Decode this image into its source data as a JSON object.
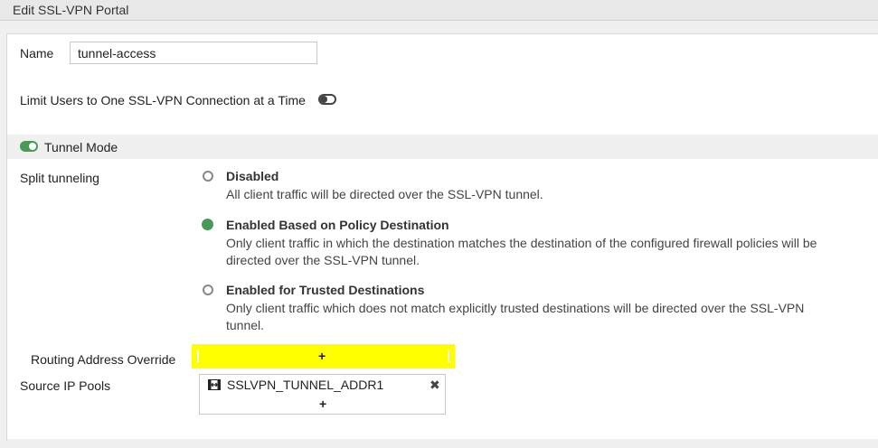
{
  "window": {
    "title": "Edit SSL-VPN Portal"
  },
  "form": {
    "name_label": "Name",
    "name_value": "tunnel-access",
    "limit_users_label": "Limit Users to One SSL-VPN Connection at a Time",
    "tunnel_mode_label": "Tunnel Mode",
    "split_tunneling_label": "Split tunneling",
    "options": [
      {
        "title": "Disabled",
        "desc1": "All client traffic will be directed over the SSL-VPN tunnel.",
        "desc2": "",
        "selected": false
      },
      {
        "title": "Enabled Based on Policy Destination",
        "desc1": "Only client traffic in which the destination matches the destination of the configured firewall policies will be",
        "desc2": "directed over the SSL-VPN tunnel.",
        "selected": true
      },
      {
        "title": "Enabled for Trusted Destinations",
        "desc1": "Only client traffic which does not match explicitly trusted destinations will be directed over the SSL-VPN",
        "desc2": "tunnel.",
        "selected": false
      }
    ],
    "routing_override_label": "Routing Address Override",
    "add_symbol": "+",
    "source_ip_pools_label": "Source IP Pools",
    "pool_entries": [
      "SSLVPN_TUNNEL_ADDR1"
    ],
    "remove_symbol": "✖"
  },
  "colors": {
    "accent_green": "#4a9a57",
    "highlight_yellow": "#ffff00"
  }
}
